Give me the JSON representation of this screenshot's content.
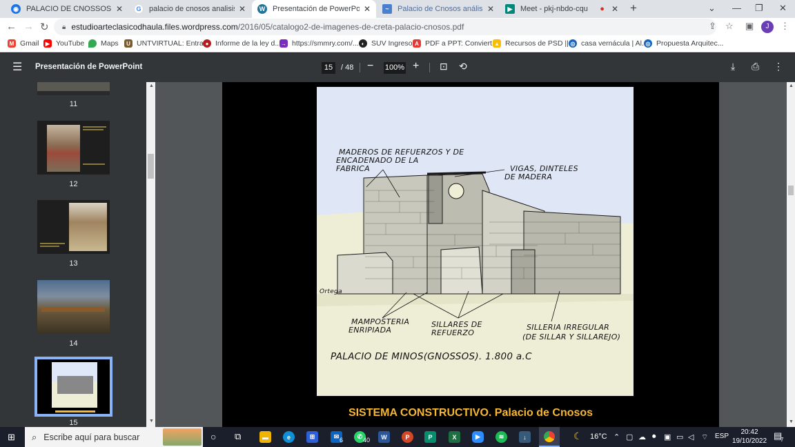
{
  "browser": {
    "tabs": [
      {
        "title": "PALACIO DE CNOSSOS - GRUPO",
        "active": false
      },
      {
        "title": "palacio de cnosos analisis - Búsq",
        "active": false
      },
      {
        "title": "Presentación de PowerPoint",
        "active": true
      },
      {
        "title": "Palacio de Cnosos análisis arquit",
        "active": false
      },
      {
        "title": "Meet - pkj-nbdo-cqu",
        "active": false
      }
    ],
    "new_tab": "+",
    "url_host": "estudioarteclasicodhaula.files.wordpress.com",
    "url_path": "/2016/05/catalogo2-de-imagenes-de-creta-palacio-cnosos.pdf",
    "profile_initial": "J",
    "bookmarks": [
      "Gmail",
      "YouTube",
      "Maps",
      "UNTVIRTUAL: Entra...",
      "Informe de la ley d...",
      "https://smmry.com/...",
      "SUV Ingreso",
      "PDF a PPT: Conviert...",
      "Recursos de PSD ||...",
      "casa vernácula | Al...",
      "Propuesta Arquitec..."
    ]
  },
  "pdf": {
    "title": "Presentación de PowerPoint",
    "current_page": "15",
    "total_pages": "/ 48",
    "zoom": "100%",
    "thumbnails": [
      "11",
      "12",
      "13",
      "14",
      "15"
    ],
    "selected_thumbnail": "15"
  },
  "slide": {
    "labels": {
      "maderos_1": "MADEROS DE REFUERZOS Y DE",
      "maderos_2": "ENCADENADO DE LA",
      "maderos_3": "FABRICA",
      "vigas_1": "VIGAS, DINTELES",
      "vigas_2": "DE MADERA",
      "mamposteria_1": "MAMPOSTERIA",
      "mamposteria_2": "ENRIPIADA",
      "sillares_1": "SILLARES DE",
      "sillares_2": "REFUERZO",
      "silleria_1": "SILLERIA IRREGULAR",
      "silleria_2": "(DE SILLAR Y SILLAREJO)",
      "signature": "Ortega",
      "title": "PALACIO DE MINOS(GNOSSOS). 1.800 a.C"
    },
    "caption": "SISTEMA CONSTRUCTIVO. Palacio de Cnosos"
  },
  "taskbar": {
    "search_placeholder": "Escribe aquí para buscar",
    "weather": "16°C",
    "language": "ESP",
    "time": "20:42",
    "date": "19/10/2022",
    "badges": {
      "mail": "6",
      "whatsapp": "40",
      "notifications": "7"
    }
  },
  "colors": {
    "accent_caption": "#f7b72f",
    "pdf_toolbar": "#323639",
    "selected_thumb_border": "#8ab4f8"
  }
}
